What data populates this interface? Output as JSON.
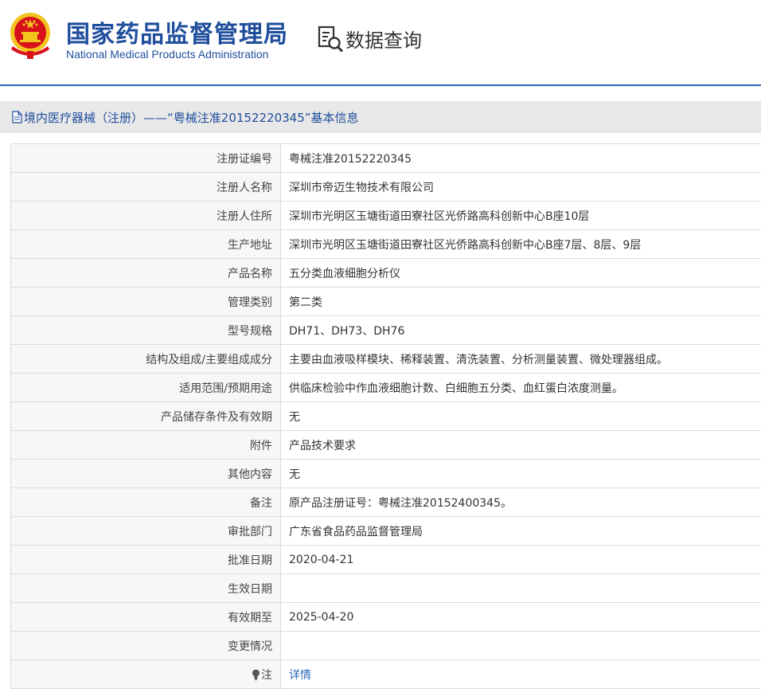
{
  "header": {
    "org_name_cn": "国家药品监督管理局",
    "org_name_en": "National Medical Products Administration",
    "query_label": "数据查询"
  },
  "title_bar": {
    "title": "境内医疗器械（注册）——“粤械注准20152220345”基本信息"
  },
  "colors": {
    "brand_blue": "#1f4e9c",
    "header_line": "#2b68b5",
    "title_bar_bg": "#e8e8e8",
    "emblem_red": "#d8111b",
    "emblem_gold": "#f2c41d"
  },
  "icons": {
    "emblem": "national-emblem-icon",
    "query": "search-document-icon",
    "doc": "document-icon",
    "note": "lightbulb-icon"
  },
  "rows": [
    {
      "label": "注册证编号",
      "value": "粤械注准20152220345"
    },
    {
      "label": "注册人名称",
      "value": "深圳市帝迈生物技术有限公司"
    },
    {
      "label": "注册人住所",
      "value": "深圳市光明区玉塘街道田寮社区光侨路高科创新中心B座10层"
    },
    {
      "label": "生产地址",
      "value": "深圳市光明区玉塘街道田寮社区光侨路高科创新中心B座7层、8层、9层"
    },
    {
      "label": "产品名称",
      "value": "五分类血液细胞分析仪"
    },
    {
      "label": "管理类别",
      "value": "第二类"
    },
    {
      "label": "型号规格",
      "value": "DH71、DH73、DH76"
    },
    {
      "label": "结构及组成/主要组成成分",
      "value": "主要由血液吸样模块、稀释装置、清洗装置、分析测量装置、微处理器组成。"
    },
    {
      "label": "适用范围/预期用途",
      "value": "供临床检验中作血液细胞计数、白细胞五分类、血红蛋白浓度测量。"
    },
    {
      "label": "产品储存条件及有效期",
      "value": "无"
    },
    {
      "label": "附件",
      "value": "产品技术要求"
    },
    {
      "label": "其他内容",
      "value": "无"
    },
    {
      "label": "备注",
      "value": "原产品注册证号：粤械注准20152400345。"
    },
    {
      "label": "审批部门",
      "value": "广东省食品药品监督管理局"
    },
    {
      "label": "批准日期",
      "value": "2020-04-21"
    },
    {
      "label": "生效日期",
      "value": ""
    },
    {
      "label": "有效期至",
      "value": "2025-04-20"
    },
    {
      "label": "变更情况",
      "value": ""
    }
  ],
  "note_row": {
    "label": "注",
    "link_text": "详情"
  }
}
